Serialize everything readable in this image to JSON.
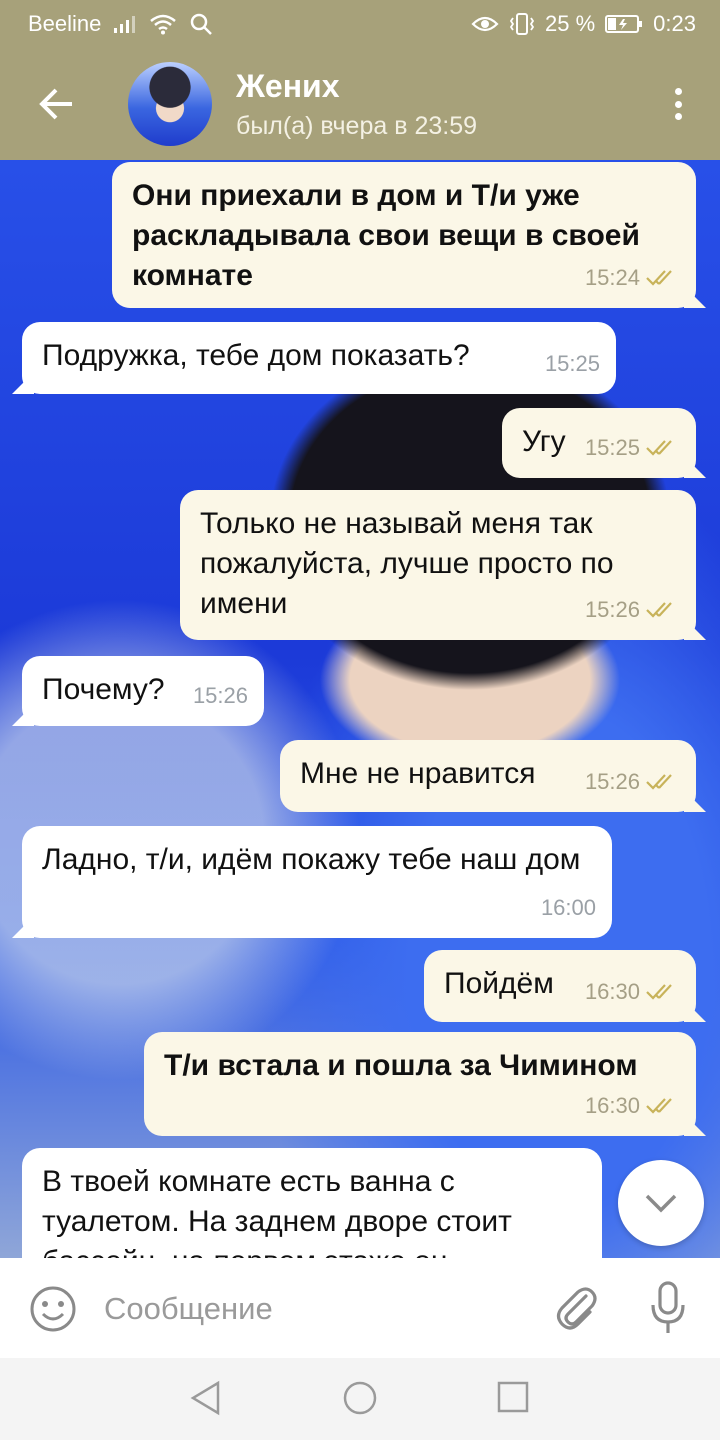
{
  "status_bar": {
    "carrier": "Beeline",
    "battery": "25 %",
    "time": "0:23"
  },
  "header": {
    "title": "Жених",
    "subtitle": "был(а) вчера в 23:59"
  },
  "messages": [
    {
      "dir": "out",
      "text": "Они приехали в дом и Т/и уже раскладывала свои вещи в своей комнате",
      "time": "15:24",
      "read": true,
      "bold": true
    },
    {
      "dir": "in",
      "text": "Подружка, тебе дом показать?",
      "time": "15:25"
    },
    {
      "dir": "out",
      "text": "Угу",
      "time": "15:25",
      "read": true
    },
    {
      "dir": "out",
      "text": "Только не называй меня так пожалуйста, лучше просто по имени",
      "time": "15:26",
      "read": true
    },
    {
      "dir": "in",
      "text": "Почему?",
      "time": "15:26"
    },
    {
      "dir": "out",
      "text": "Мне не нравится",
      "time": "15:26",
      "read": true
    },
    {
      "dir": "in",
      "text": "Ладно, т/и, идём покажу тебе наш дом",
      "time": "16:00"
    },
    {
      "dir": "out",
      "text": "Пойдём",
      "time": "16:30",
      "read": true
    },
    {
      "dir": "out",
      "text": "Т/и встала и пошла за Чимином",
      "time": "16:30",
      "read": true,
      "bold": true
    },
    {
      "dir": "in",
      "text": "В твоей комнате есть ванна с туалетом. На заднем дворе стоит бассейн, на первом этаже он",
      "time": ""
    }
  ],
  "composer": {
    "placeholder": "Сообщение"
  },
  "icons": {
    "back": "arrow-left-icon",
    "menu": "more-vert-icon",
    "emoji": "smile-icon",
    "attach": "paperclip-icon",
    "mic": "microphone-icon",
    "scroll": "chevron-down-icon"
  },
  "colors": {
    "header": "#a7a17a",
    "outgoing_bubble": "#fbf7e7",
    "incoming_bubble": "#ffffff",
    "read_ticks": "#c8b35a"
  }
}
